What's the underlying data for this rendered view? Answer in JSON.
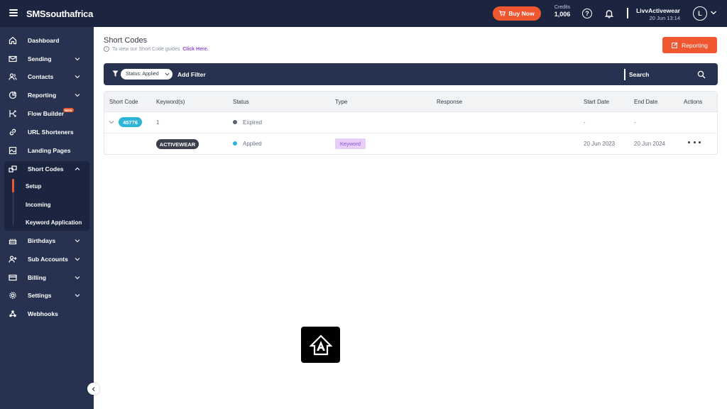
{
  "header": {
    "logo": "SMSsouthafrica",
    "buy_now": "Buy Now",
    "credits_label": "Credits",
    "credits_value": "1,006",
    "account_name": "LivvActivewear",
    "account_datetime": "20 Jun 13:14",
    "avatar_initial": "L"
  },
  "sidebar": {
    "items": [
      {
        "label": "Dashboard",
        "icon": "home-icon"
      },
      {
        "label": "Sending",
        "icon": "mail-icon"
      },
      {
        "label": "Contacts",
        "icon": "contacts-icon"
      },
      {
        "label": "Reporting",
        "icon": "pie-chart-icon"
      },
      {
        "label": "Flow Builder",
        "icon": "flow-icon",
        "badge": "NEW"
      },
      {
        "label": "URL Shorteners",
        "icon": "link-icon"
      },
      {
        "label": "Landing Pages",
        "icon": "landing-page-icon"
      },
      {
        "label": "Short Codes",
        "icon": "short-codes-icon"
      },
      {
        "label": "Birthdays",
        "icon": "cake-icon"
      },
      {
        "label": "Sub Accounts",
        "icon": "user-plus-icon"
      },
      {
        "label": "Billing",
        "icon": "credit-card-icon"
      },
      {
        "label": "Settings",
        "icon": "gear-icon"
      },
      {
        "label": "Webhooks",
        "icon": "webhooks-icon"
      }
    ],
    "sub_items": [
      "Setup",
      "Incoming",
      "Keyword Application"
    ]
  },
  "page": {
    "title": "Short Codes",
    "subtitle": "To view our Short Code guides",
    "subtitle_link": "Click Here.",
    "reporting_button": "Reporting"
  },
  "filter": {
    "status_chip": "Status: Applied",
    "add_filter": "Add Filter",
    "search_label": "Search"
  },
  "table": {
    "columns": [
      "Short Code",
      "Keyword(s)",
      "Status",
      "Type",
      "Response",
      "Start Date",
      "End Date",
      "Actions"
    ],
    "parent_row": {
      "short_code": "45776",
      "keyword_count": "1",
      "status": "Expired",
      "start_date": "-",
      "end_date": "-"
    },
    "child_row": {
      "keyword": "ACTIVEWEAR",
      "status": "Applied",
      "type": "Keyword",
      "start_date": "20 Jun 2023",
      "end_date": "20 Jun 2024"
    }
  },
  "colors": {
    "header_bg": "#1b2540",
    "sidebar_bg": "#273250",
    "accent_orange": "#f0562f",
    "code_badge": "#2cb5d9",
    "status_expired": "#5a6174",
    "status_applied": "#2cb5d9",
    "type_badge_bg": "#e7cff9",
    "link_purple": "#8e4fd8"
  }
}
